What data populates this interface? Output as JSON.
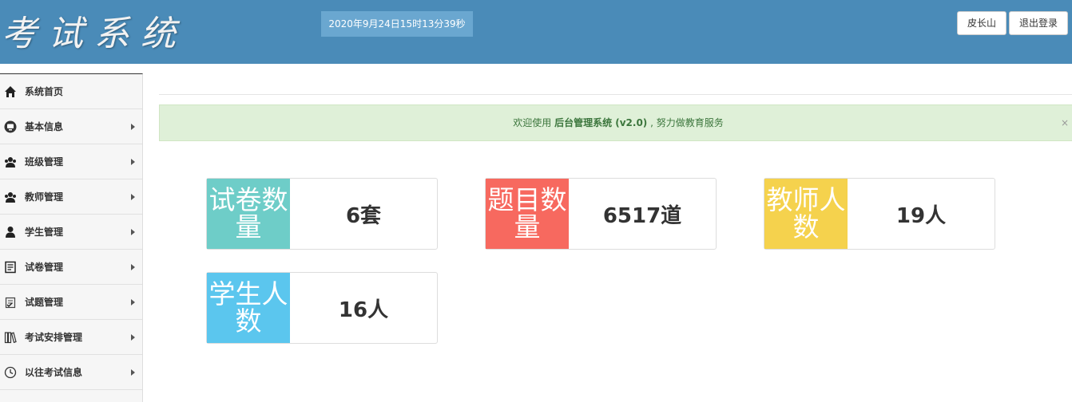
{
  "header": {
    "logo_text": "考试系统",
    "datetime": "2020年9月24日15时13分39秒",
    "user_label": "皮长山",
    "logout_label": "退出登录"
  },
  "sidebar": {
    "items": [
      {
        "label": "系统首页",
        "icon": "home-icon"
      },
      {
        "label": "基本信息",
        "icon": "monitor-icon"
      },
      {
        "label": "班级管理",
        "icon": "users-icon"
      },
      {
        "label": "教师管理",
        "icon": "users-icon"
      },
      {
        "label": "学生管理",
        "icon": "user-icon"
      },
      {
        "label": "试卷管理",
        "icon": "document-icon"
      },
      {
        "label": "试题管理",
        "icon": "checklist-icon"
      },
      {
        "label": "考试安排管理",
        "icon": "books-icon"
      },
      {
        "label": "以往考试信息",
        "icon": "clock-icon"
      }
    ]
  },
  "alert": {
    "prefix": "欢迎使用",
    "title": "后台管理系统 (v2.0)",
    "suffix": ", 努力做教育服务",
    "close": "×"
  },
  "stats": [
    {
      "label": "试卷数量",
      "value": "6套",
      "color": "#6ecdc8"
    },
    {
      "label": "题目数量",
      "value": "6517道",
      "color": "#f7695f"
    },
    {
      "label": "教师人数",
      "value": "19人",
      "color": "#f5d24d"
    },
    {
      "label": "学生人数",
      "value": "16人",
      "color": "#5bc6ee"
    }
  ]
}
